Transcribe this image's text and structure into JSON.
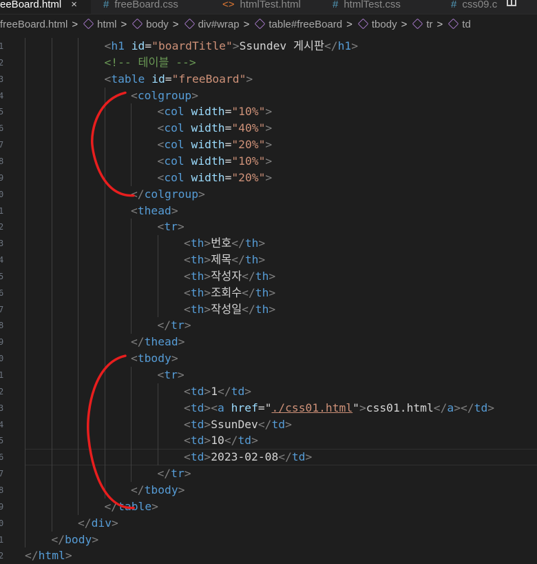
{
  "tabs": [
    {
      "icon": "html-file-icon",
      "label": "eeBoard.html",
      "active": true,
      "close": "×"
    },
    {
      "icon": "css-file-icon",
      "label": "freeBoard.css",
      "active": false
    },
    {
      "icon": "html-file-icon",
      "label": "htmlTest.html",
      "active": false
    },
    {
      "icon": "css-file-icon",
      "label": "htmlTest.css",
      "active": false
    },
    {
      "icon": "css-file-icon",
      "label": "css09.c",
      "active": false
    }
  ],
  "tab_symbols": {
    "css": "#",
    "html": "<>"
  },
  "breadcrumb": [
    {
      "label": "freeBoard.html",
      "icon": false
    },
    {
      "label": "html",
      "icon": true
    },
    {
      "label": "body",
      "icon": true
    },
    {
      "label": "div#wrap",
      "icon": true
    },
    {
      "label": "table#freeBoard",
      "icon": true
    },
    {
      "label": "tbody",
      "icon": true
    },
    {
      "label": "tr",
      "icon": true
    },
    {
      "label": "td",
      "icon": true
    }
  ],
  "breadcrumb_separator": ">",
  "line_numbers": [
    "1",
    "2",
    "3",
    "4",
    "5",
    "6",
    "7",
    "8",
    "9",
    "0",
    "1",
    "2",
    "3",
    "4",
    "5",
    "6",
    "7",
    "8",
    "9",
    "0",
    "1",
    "2",
    "3",
    "4",
    "5",
    "6",
    "7",
    "8",
    "9",
    "0",
    "1",
    "2"
  ],
  "current_line_index": 25,
  "colors": {
    "tag": "#569cd6",
    "attr": "#9cdcfe",
    "value": "#ce9178",
    "comment": "#6a9955",
    "text": "#d4d4d4",
    "punct": "#808080",
    "annotation": "#e81e1e"
  },
  "code_lines": [
    {
      "indent": 3,
      "tokens": [
        [
          "p",
          "<"
        ],
        [
          "t",
          "h1"
        ],
        [
          "x",
          " "
        ],
        [
          "a",
          "id"
        ],
        [
          "x",
          "="
        ],
        [
          "v",
          "\"boardTitle\""
        ],
        [
          "p",
          ">"
        ],
        [
          "x",
          "Ssundev 게시판"
        ],
        [
          "p",
          "</"
        ],
        [
          "t",
          "h1"
        ],
        [
          "p",
          ">"
        ]
      ]
    },
    {
      "indent": 3,
      "tokens": [
        [
          "c",
          "<!-- 테이블 -->"
        ]
      ]
    },
    {
      "indent": 3,
      "tokens": [
        [
          "p",
          "<"
        ],
        [
          "t",
          "table"
        ],
        [
          "x",
          " "
        ],
        [
          "a",
          "id"
        ],
        [
          "x",
          "="
        ],
        [
          "v",
          "\"freeBoard\""
        ],
        [
          "p",
          ">"
        ]
      ]
    },
    {
      "indent": 4,
      "tokens": [
        [
          "p",
          "<"
        ],
        [
          "t",
          "colgroup"
        ],
        [
          "p",
          ">"
        ]
      ]
    },
    {
      "indent": 5,
      "tokens": [
        [
          "p",
          "<"
        ],
        [
          "t",
          "col"
        ],
        [
          "x",
          " "
        ],
        [
          "a",
          "width"
        ],
        [
          "x",
          "="
        ],
        [
          "v",
          "\"10%\""
        ],
        [
          "p",
          ">"
        ]
      ]
    },
    {
      "indent": 5,
      "tokens": [
        [
          "p",
          "<"
        ],
        [
          "t",
          "col"
        ],
        [
          "x",
          " "
        ],
        [
          "a",
          "width"
        ],
        [
          "x",
          "="
        ],
        [
          "v",
          "\"40%\""
        ],
        [
          "p",
          ">"
        ]
      ]
    },
    {
      "indent": 5,
      "tokens": [
        [
          "p",
          "<"
        ],
        [
          "t",
          "col"
        ],
        [
          "x",
          " "
        ],
        [
          "a",
          "width"
        ],
        [
          "x",
          "="
        ],
        [
          "v",
          "\"20%\""
        ],
        [
          "p",
          ">"
        ]
      ]
    },
    {
      "indent": 5,
      "tokens": [
        [
          "p",
          "<"
        ],
        [
          "t",
          "col"
        ],
        [
          "x",
          " "
        ],
        [
          "a",
          "width"
        ],
        [
          "x",
          "="
        ],
        [
          "v",
          "\"10%\""
        ],
        [
          "p",
          ">"
        ]
      ]
    },
    {
      "indent": 5,
      "tokens": [
        [
          "p",
          "<"
        ],
        [
          "t",
          "col"
        ],
        [
          "x",
          " "
        ],
        [
          "a",
          "width"
        ],
        [
          "x",
          "="
        ],
        [
          "v",
          "\"20%\""
        ],
        [
          "p",
          ">"
        ]
      ]
    },
    {
      "indent": 4,
      "tokens": [
        [
          "p",
          "</"
        ],
        [
          "t",
          "colgroup"
        ],
        [
          "p",
          ">"
        ]
      ]
    },
    {
      "indent": 4,
      "tokens": [
        [
          "p",
          "<"
        ],
        [
          "t",
          "thead"
        ],
        [
          "p",
          ">"
        ]
      ]
    },
    {
      "indent": 5,
      "tokens": [
        [
          "p",
          "<"
        ],
        [
          "t",
          "tr"
        ],
        [
          "p",
          ">"
        ]
      ]
    },
    {
      "indent": 6,
      "tokens": [
        [
          "p",
          "<"
        ],
        [
          "t",
          "th"
        ],
        [
          "p",
          ">"
        ],
        [
          "x",
          "번호"
        ],
        [
          "p",
          "</"
        ],
        [
          "t",
          "th"
        ],
        [
          "p",
          ">"
        ]
      ]
    },
    {
      "indent": 6,
      "tokens": [
        [
          "p",
          "<"
        ],
        [
          "t",
          "th"
        ],
        [
          "p",
          ">"
        ],
        [
          "x",
          "제목"
        ],
        [
          "p",
          "</"
        ],
        [
          "t",
          "th"
        ],
        [
          "p",
          ">"
        ]
      ]
    },
    {
      "indent": 6,
      "tokens": [
        [
          "p",
          "<"
        ],
        [
          "t",
          "th"
        ],
        [
          "p",
          ">"
        ],
        [
          "x",
          "작성자"
        ],
        [
          "p",
          "</"
        ],
        [
          "t",
          "th"
        ],
        [
          "p",
          ">"
        ]
      ]
    },
    {
      "indent": 6,
      "tokens": [
        [
          "p",
          "<"
        ],
        [
          "t",
          "th"
        ],
        [
          "p",
          ">"
        ],
        [
          "x",
          "조회수"
        ],
        [
          "p",
          "</"
        ],
        [
          "t",
          "th"
        ],
        [
          "p",
          ">"
        ]
      ]
    },
    {
      "indent": 6,
      "tokens": [
        [
          "p",
          "<"
        ],
        [
          "t",
          "th"
        ],
        [
          "p",
          ">"
        ],
        [
          "x",
          "작성일"
        ],
        [
          "p",
          "</"
        ],
        [
          "t",
          "th"
        ],
        [
          "p",
          ">"
        ]
      ]
    },
    {
      "indent": 5,
      "tokens": [
        [
          "p",
          "</"
        ],
        [
          "t",
          "tr"
        ],
        [
          "p",
          ">"
        ]
      ]
    },
    {
      "indent": 4,
      "tokens": [
        [
          "p",
          "</"
        ],
        [
          "t",
          "thead"
        ],
        [
          "p",
          ">"
        ]
      ]
    },
    {
      "indent": 4,
      "tokens": [
        [
          "p",
          "<"
        ],
        [
          "t",
          "tbody"
        ],
        [
          "p",
          ">"
        ]
      ]
    },
    {
      "indent": 5,
      "tokens": [
        [
          "p",
          "<"
        ],
        [
          "t",
          "tr"
        ],
        [
          "p",
          ">"
        ]
      ]
    },
    {
      "indent": 6,
      "tokens": [
        [
          "p",
          "<"
        ],
        [
          "t",
          "td"
        ],
        [
          "p",
          ">"
        ],
        [
          "x",
          "1"
        ],
        [
          "p",
          "</"
        ],
        [
          "t",
          "td"
        ],
        [
          "p",
          ">"
        ]
      ]
    },
    {
      "indent": 6,
      "tokens": [
        [
          "p",
          "<"
        ],
        [
          "t",
          "td"
        ],
        [
          "p",
          ">"
        ],
        [
          "p",
          "<"
        ],
        [
          "t",
          "a"
        ],
        [
          "x",
          " "
        ],
        [
          "a",
          "href"
        ],
        [
          "x",
          "=\""
        ],
        [
          "v.u",
          "./css01.html"
        ],
        [
          "x",
          "\""
        ],
        [
          "p",
          ">"
        ],
        [
          "x",
          "css01.html"
        ],
        [
          "p",
          "</"
        ],
        [
          "t",
          "a"
        ],
        [
          "p",
          "></"
        ],
        [
          "t",
          "td"
        ],
        [
          "p",
          ">"
        ]
      ]
    },
    {
      "indent": 6,
      "tokens": [
        [
          "p",
          "<"
        ],
        [
          "t",
          "td"
        ],
        [
          "p",
          ">"
        ],
        [
          "x",
          "SsunDev"
        ],
        [
          "p",
          "</"
        ],
        [
          "t",
          "td"
        ],
        [
          "p",
          ">"
        ]
      ]
    },
    {
      "indent": 6,
      "tokens": [
        [
          "p",
          "<"
        ],
        [
          "t",
          "td"
        ],
        [
          "p",
          ">"
        ],
        [
          "x",
          "10"
        ],
        [
          "p",
          "</"
        ],
        [
          "t",
          "td"
        ],
        [
          "p",
          ">"
        ]
      ]
    },
    {
      "indent": 6,
      "tokens": [
        [
          "p",
          "<"
        ],
        [
          "t",
          "td"
        ],
        [
          "p",
          ">"
        ],
        [
          "x",
          "2023-02-08"
        ],
        [
          "p",
          "</"
        ],
        [
          "t",
          "td"
        ],
        [
          "p",
          ">"
        ]
      ]
    },
    {
      "indent": 5,
      "tokens": [
        [
          "p",
          "</"
        ],
        [
          "t",
          "tr"
        ],
        [
          "p",
          ">"
        ]
      ]
    },
    {
      "indent": 4,
      "tokens": [
        [
          "p",
          "</"
        ],
        [
          "t",
          "tbody"
        ],
        [
          "p",
          ">"
        ]
      ]
    },
    {
      "indent": 3,
      "tokens": [
        [
          "p",
          "</"
        ],
        [
          "t",
          "table"
        ],
        [
          "p",
          ">"
        ]
      ]
    },
    {
      "indent": 2,
      "tokens": [
        [
          "p",
          "</"
        ],
        [
          "t",
          "div"
        ],
        [
          "p",
          ">"
        ]
      ]
    },
    {
      "indent": 1,
      "tokens": [
        [
          "p",
          "</"
        ],
        [
          "t",
          "body"
        ],
        [
          "p",
          ">"
        ]
      ]
    },
    {
      "indent": 0,
      "tokens": [
        [
          "p",
          "</"
        ],
        [
          "t",
          "html"
        ],
        [
          "p",
          ">"
        ]
      ]
    }
  ],
  "annotation_brackets": [
    {
      "name": "colgroup-bracket",
      "from_line": 3,
      "to_line": 9
    },
    {
      "name": "tbody-bracket",
      "from_line": 19,
      "to_line": 28
    }
  ]
}
